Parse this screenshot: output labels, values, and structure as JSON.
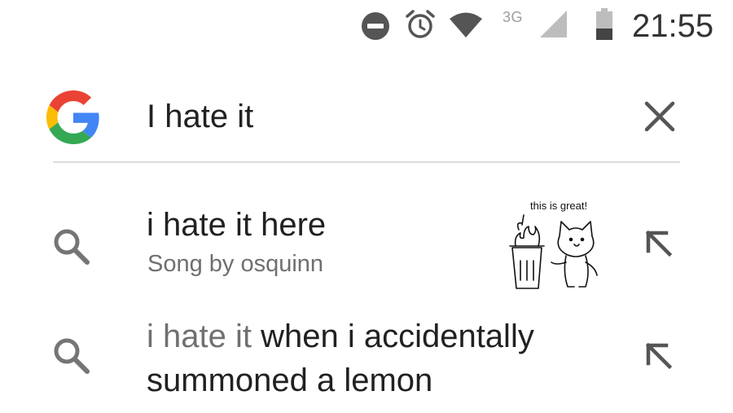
{
  "status_bar": {
    "icons": [
      "do-not-disturb-icon",
      "alarm-icon",
      "wifi-icon",
      "cell-signal-icon",
      "battery-icon"
    ],
    "network": "3G",
    "time": "21:55"
  },
  "search": {
    "query": "I hate it",
    "logo": "google-g-icon",
    "clear_icon": "close-icon"
  },
  "suggestions": [
    {
      "title": "i hate it here",
      "subtitle": "Song by osquinn",
      "thumbnail_caption": "this is great!",
      "icon": "search-icon",
      "action_icon": "arrow-up-left-icon"
    },
    {
      "match": "i hate it",
      "rest": " when i accidentally summoned a lemon",
      "icon": "search-icon",
      "action_icon": "arrow-up-left-icon"
    }
  ],
  "colors": {
    "google_blue": "#4285F4",
    "google_red": "#EA4335",
    "google_yellow": "#FBBC05",
    "google_green": "#34A853",
    "icon_gray": "#757575"
  }
}
